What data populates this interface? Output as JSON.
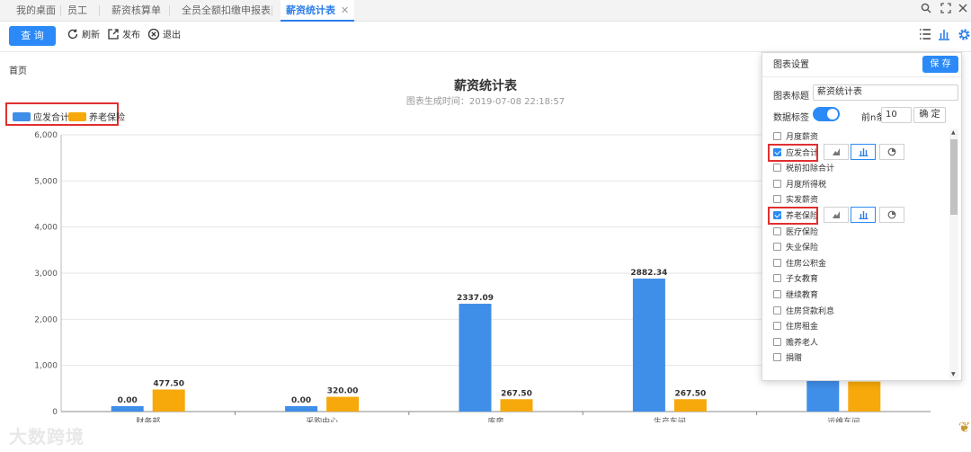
{
  "tabs": [
    {
      "label": "我的桌面",
      "active": false
    },
    {
      "label": "员工",
      "active": false
    },
    {
      "label": "薪资核算单",
      "active": false
    },
    {
      "label": "全员全额扣缴申报表",
      "active": false
    },
    {
      "label": "薪资统计表",
      "active": true,
      "closable": true
    }
  ],
  "window_icons": [
    "search-icon",
    "expand-icon",
    "close-icon"
  ],
  "toolbar": {
    "query": "查 询",
    "refresh": "刷新",
    "publish": "发布",
    "exit": "退出",
    "right_icons": [
      "list-icon",
      "bar-chart-icon",
      "gear-icon"
    ]
  },
  "breadcrumb": "首页",
  "colors": {
    "accent": "#2b8af7",
    "series1": "#3f8ee8",
    "series2": "#f7a80a",
    "highlight": "#e03030"
  },
  "chart_data": {
    "type": "bar",
    "title": "薪资统计表",
    "subtitle": "图表生成时间：2019-07-08 22:18:57",
    "categories": [
      "财务部",
      "采购中心",
      "库房",
      "生产车间",
      "运维车间"
    ],
    "series": [
      {
        "name": "应发合计",
        "values": [
          0.0,
          0.0,
          2337.09,
          2882.34,
          1700
        ]
      },
      {
        "name": "养老保险",
        "values": [
          477.5,
          320.0,
          267.5,
          267.5,
          650
        ]
      }
    ],
    "data_labels": [
      [
        "0.00",
        "0.00",
        "2337.09",
        "2882.34",
        ""
      ],
      [
        "477.50",
        "320.00",
        "267.50",
        "267.50",
        ""
      ]
    ],
    "ylim": [
      0,
      6000
    ],
    "yticks": [
      0,
      1000,
      2000,
      3000,
      4000,
      5000,
      6000
    ],
    "ytick_labels": [
      "0",
      "1,000",
      "2,000",
      "3,000",
      "4,000",
      "5,000",
      "6,000"
    ],
    "grid": true,
    "legend_position": "top-left"
  },
  "panel": {
    "title": "图表设置",
    "save": "保 存",
    "chart_title_label": "图表标题",
    "chart_title_value": "薪资统计表",
    "data_label_label": "数据标签",
    "data_label_on": true,
    "top_n_label": "前n条",
    "top_n_value": "10",
    "confirm": "确 定",
    "fields": [
      {
        "label": "月度薪资",
        "checked": false
      },
      {
        "label": "应发合计",
        "checked": true,
        "highlight": true
      },
      {
        "label": "税前扣除合计",
        "checked": false
      },
      {
        "label": "月度所得税",
        "checked": false
      },
      {
        "label": "实发薪资",
        "checked": false
      },
      {
        "label": "养老保险",
        "checked": true,
        "highlight": true
      },
      {
        "label": "医疗保险",
        "checked": false
      },
      {
        "label": "失业保险",
        "checked": false
      },
      {
        "label": "住房公积金",
        "checked": false
      },
      {
        "label": "子女教育",
        "checked": false
      },
      {
        "label": "继续教育",
        "checked": false
      },
      {
        "label": "住房贷款利息",
        "checked": false
      },
      {
        "label": "住房租金",
        "checked": false
      },
      {
        "label": "赡养老人",
        "checked": false
      },
      {
        "label": "捐赠",
        "checked": false
      }
    ],
    "chart_type_icons": [
      "area-chart-icon",
      "bar-chart-icon",
      "pie-chart-icon"
    ]
  },
  "watermark": "大数跨境"
}
